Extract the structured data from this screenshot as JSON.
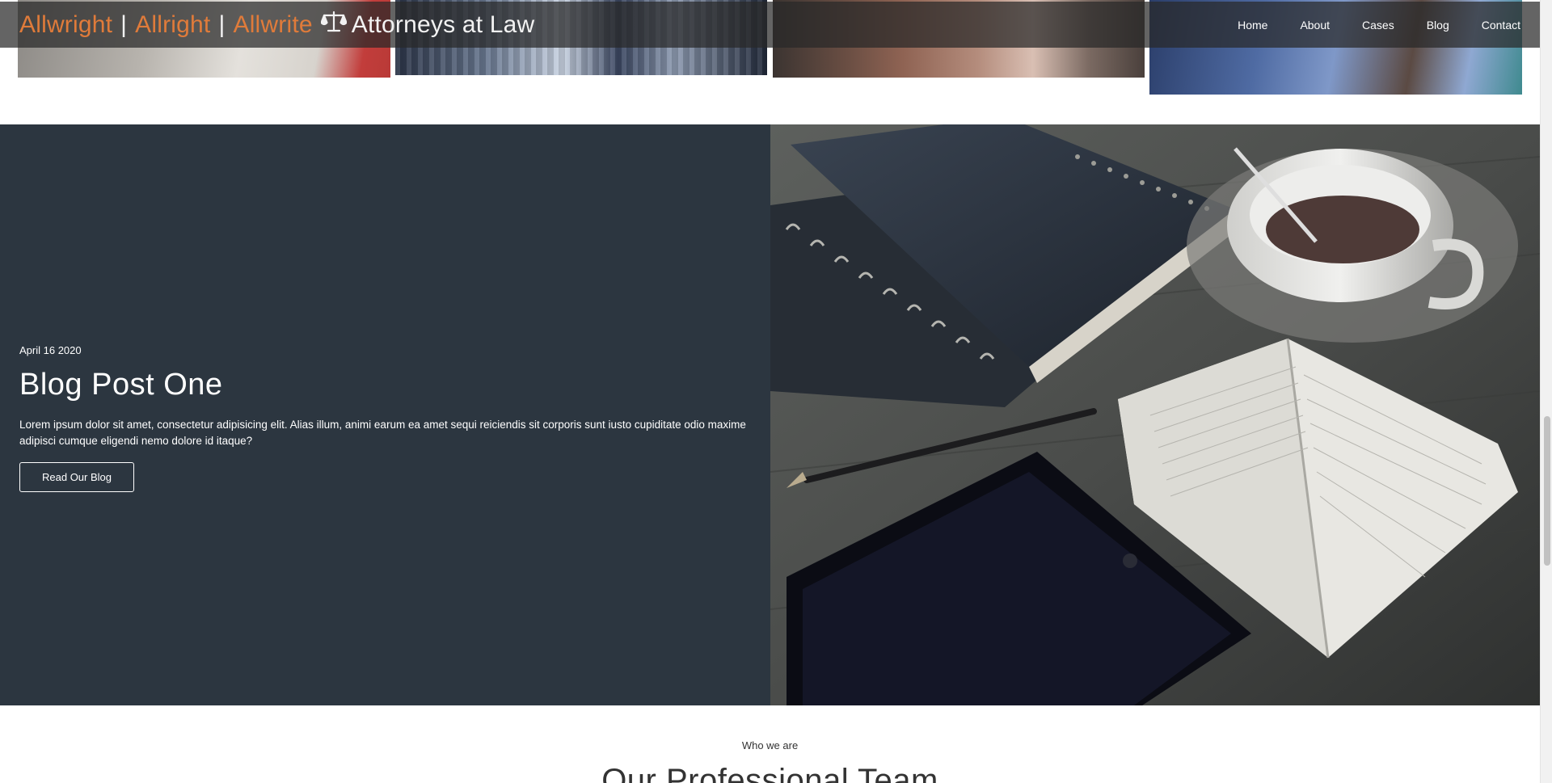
{
  "header": {
    "brand": {
      "part1": "Allwright",
      "separator1": "|",
      "part2": "Allright",
      "separator2": "|",
      "part3": "Allwrite",
      "icon": "scales-icon",
      "firm": "Attorneys at Law"
    },
    "nav": [
      {
        "label": "Home"
      },
      {
        "label": "About"
      },
      {
        "label": "Cases"
      },
      {
        "label": "Blog"
      },
      {
        "label": "Contact"
      }
    ]
  },
  "blog_feature": {
    "date": "April 16 2020",
    "title": "Blog Post One",
    "excerpt": "Lorem ipsum dolor sit amet, consectetur adipisicing elit. Alias illum, animi earum ea amet sequi reiciendis sit corporis sunt iusto cupiditate odio maxime adipisci cumque eligendi nemo dolore id itaque?",
    "button_label": "Read Our Blog"
  },
  "team_intro": {
    "kicker": "Who we are",
    "heading": "Our Professional Team"
  },
  "colors": {
    "accent": "#e07b3a",
    "dark_panel": "#2c3640",
    "header_overlay": "rgba(40,40,40,0.72)"
  }
}
